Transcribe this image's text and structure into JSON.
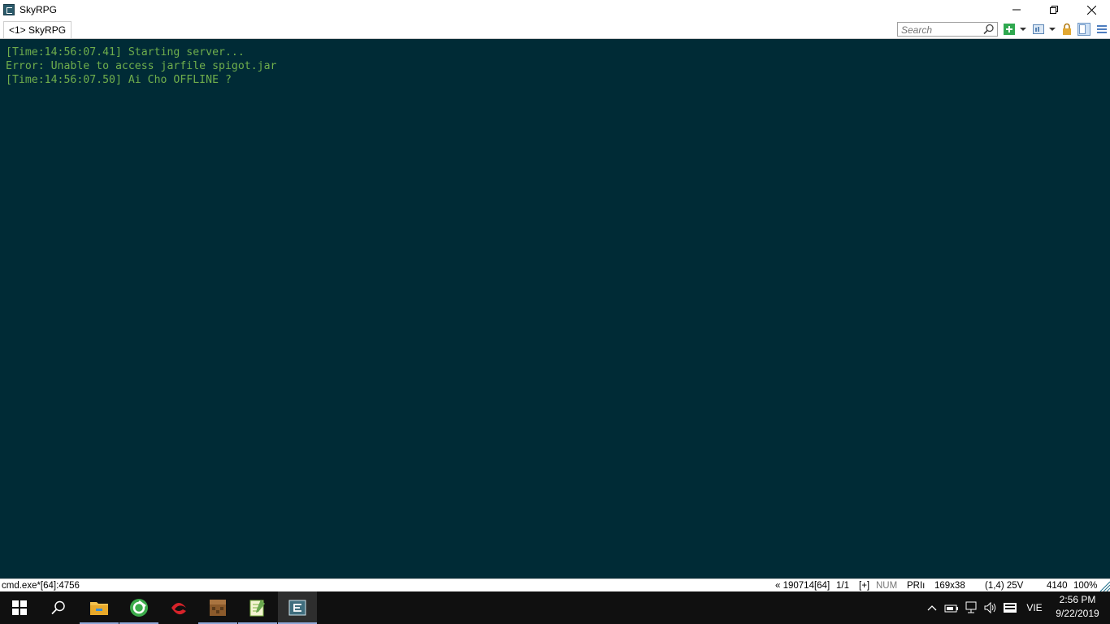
{
  "window": {
    "title": "SkyRPG",
    "controls": {
      "minimize": "—",
      "restore": "❐",
      "close": "✕"
    }
  },
  "tabs": [
    {
      "label": "<1> SkyRPG"
    }
  ],
  "toolbar": {
    "search_placeholder": "Search",
    "icons": [
      "search-icon",
      "new-console-icon",
      "dropdown-icon",
      "view-icon",
      "dropdown-icon",
      "lock-icon",
      "panel-icon",
      "menu-icon"
    ]
  },
  "console": {
    "lines": [
      "[Time:14:56:07.41] Starting server...",
      "Error: Unable to access jarfile spigot.jar",
      "[Time:14:56:07.50] Ai Cho OFFLINE ?"
    ],
    "text_color": "#6fae4c",
    "background": "#002b36"
  },
  "statusbar": {
    "process": "cmd.exe*[64]:4756",
    "build": "« 190714[64]",
    "pages": "1/1",
    "plus": "[+]",
    "num": "NUM",
    "pri": "PRIı",
    "size": "169x38",
    "cursor": "(1,4) 25V",
    "pid": "4140",
    "zoom": "100%"
  },
  "taskbar": {
    "apps": [
      "start-icon",
      "search-icon",
      "file-explorer-icon",
      "browser-icon",
      "game-launcher-icon",
      "minecraft-icon",
      "notepad-icon",
      "conemu-icon"
    ],
    "language": "VIE",
    "time": "2:56 PM",
    "date": "9/22/2019"
  }
}
